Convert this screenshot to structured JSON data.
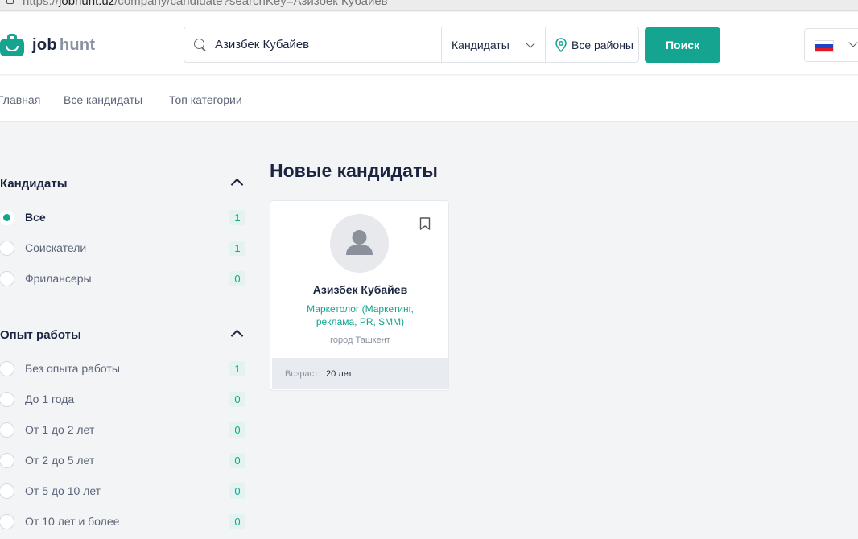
{
  "browser": {
    "url_prefix": "https://",
    "url_host": "jobhunt.uz",
    "url_path": "/company/candidate?searchKey=Азизбек Кубайев"
  },
  "header": {
    "logo_part1": "job",
    "logo_part2": "hunt",
    "search_value": "Азизбек Кубайев",
    "category_selected": "Кандидаты",
    "region_selected": "Все районы",
    "search_button": "Поиск",
    "language_flag": "russian-flag-icon"
  },
  "nav": {
    "items": [
      "Главная",
      "Все кандидаты",
      "Топ категории"
    ]
  },
  "sidebar": {
    "candidates": {
      "title": "Кандидаты",
      "options": [
        {
          "label": "Все",
          "count": "1",
          "checked": true
        },
        {
          "label": "Соискатели",
          "count": "1",
          "checked": false
        },
        {
          "label": "Фрилансеры",
          "count": "0",
          "checked": false
        }
      ]
    },
    "experience": {
      "title": "Опыт работы",
      "options": [
        {
          "label": "Без опыта работы",
          "count": "1"
        },
        {
          "label": "До 1 года",
          "count": "0"
        },
        {
          "label": "От 1 до 2 лет",
          "count": "0"
        },
        {
          "label": "От 2 до 5 лет",
          "count": "0"
        },
        {
          "label": "От 5 до 10 лет",
          "count": "0"
        },
        {
          "label": "От 10 лет и более",
          "count": "0"
        }
      ]
    }
  },
  "main": {
    "title": "Новые кандидаты",
    "card": {
      "name": "Азизбек Кубайев",
      "profession": "Маркетолог (Маркетинг, реклама, PR, SMM)",
      "city": "город Ташкент",
      "age_label": "Возраст:",
      "age_value": "20 лет"
    }
  },
  "colors": {
    "accent": "#15a48f",
    "text": "#1b2540",
    "muted": "#5b6478",
    "background": "#f3f4f6"
  }
}
